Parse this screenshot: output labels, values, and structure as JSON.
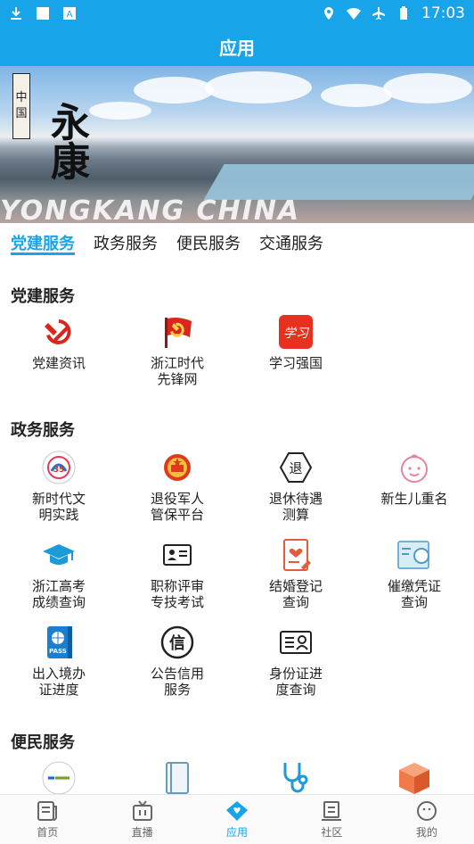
{
  "status_bar": {
    "time": "17:03"
  },
  "app_bar": {
    "title": "应用"
  },
  "banner": {
    "seal_chars": [
      "中",
      "国"
    ],
    "calligraphy": "永康",
    "watermark": "YONGKANG CHINA"
  },
  "tabs": [
    "党建服务",
    "政务服务",
    "便民服务",
    "交通服务"
  ],
  "sections": {
    "party": {
      "title": "党建服务",
      "items": [
        {
          "label1": "党建资讯",
          "label2": "",
          "icon": "hammer-sickle-icon"
        },
        {
          "label1": "浙江时代",
          "label2": "先锋网",
          "icon": "party-flag-icon"
        },
        {
          "label1": "学习强国",
          "label2": "",
          "icon": "xuexi-qiangguo-icon"
        }
      ]
    },
    "gov": {
      "title": "政务服务",
      "items": [
        {
          "label1": "新时代文",
          "label2": "明实践",
          "icon": "civilization-practice-icon"
        },
        {
          "label1": "退役军人",
          "label2": "管保平台",
          "icon": "national-emblem-icon"
        },
        {
          "label1": "退休待遇",
          "label2": "测算",
          "icon": "retire-icon"
        },
        {
          "label1": "新生儿重名",
          "label2": "",
          "icon": "baby-face-icon"
        },
        {
          "label1": "浙江高考",
          "label2": "成绩查询",
          "icon": "graduation-cap-icon"
        },
        {
          "label1": "职称评审",
          "label2": "专技考试",
          "icon": "id-card-icon"
        },
        {
          "label1": "结婚登记",
          "label2": "查询",
          "icon": "marriage-certificate-icon"
        },
        {
          "label1": "催缴凭证",
          "label2": "查询",
          "icon": "voucher-search-icon"
        },
        {
          "label1": "出入境办",
          "label2": "证进度",
          "icon": "passport-icon"
        },
        {
          "label1": "公告信用",
          "label2": "服务",
          "icon": "credit-icon"
        },
        {
          "label1": "身份证进",
          "label2": "度查询",
          "icon": "id-card-person-icon"
        }
      ]
    },
    "convenience": {
      "title": "便民服务",
      "items": [
        {
          "icon": "service-logo-icon"
        },
        {
          "icon": "book-icon"
        },
        {
          "icon": "stethoscope-icon"
        },
        {
          "icon": "package-box-icon"
        }
      ]
    }
  },
  "bottom_nav": [
    {
      "label": "首页",
      "icon": "home-news-icon"
    },
    {
      "label": "直播",
      "icon": "tv-icon"
    },
    {
      "label": "应用",
      "icon": "apps-heart-icon",
      "active": true
    },
    {
      "label": "社区",
      "icon": "community-icon"
    },
    {
      "label": "我的",
      "icon": "profile-face-icon"
    }
  ],
  "colors": {
    "accent": "#18a4e8",
    "party_red": "#d9251d"
  }
}
